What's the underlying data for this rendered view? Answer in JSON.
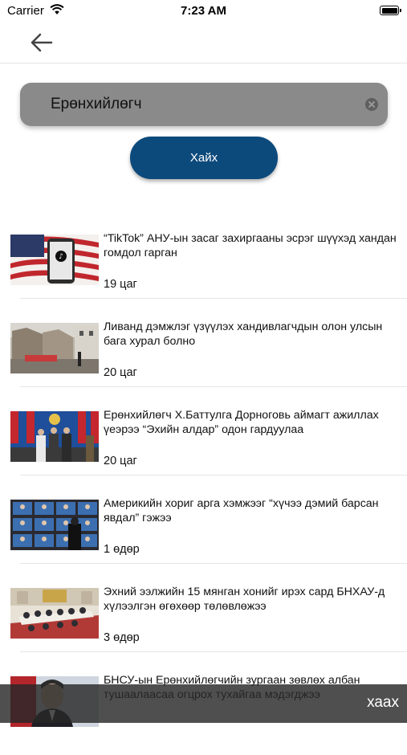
{
  "status_bar": {
    "carrier": "Carrier",
    "time": "7:23 AM"
  },
  "search": {
    "value": "Ерөнхийлөгч",
    "button_label": "Хайх"
  },
  "news": [
    {
      "title": "“TikTok” АНУ-ын засаг захиргааны эсрэг шүүхэд хандан гомдол гарган",
      "age": "19 цаг",
      "thumb": "tiktok-flag"
    },
    {
      "title": "Ливанд дэмжлэг үзүүлэх хандивлагчдын олон улсын бага хурал болно",
      "age": "20 цаг",
      "thumb": "ruins"
    },
    {
      "title": "Ерөнхийлөгч Х.Баттулга Дорноговь аймагт ажиллах үеэрээ “Эхийн алдар” одон гардуулаа",
      "age": "20 цаг",
      "thumb": "ceremony"
    },
    {
      "title": "Америкийн хориг арга хэмжээг “хүчээ дэмий барсан явдал” гэжээ",
      "age": "1 өдөр",
      "thumb": "video-wall"
    },
    {
      "title": "Эхний ээлжийн 15 мянган хонийг ирэх сард БНХАУ-д хүлээлгэн өгөхөөр төлөвлөжээ",
      "age": "3 өдөр",
      "thumb": "meeting"
    },
    {
      "title": "БНСУ-ын Ерөнхийлөгчийн зургаан зөвлөх албан тушаалаасаа огцрох тухайгаа мэдэгджээ",
      "age": "",
      "thumb": "portrait"
    }
  ],
  "banner": {
    "close_label": "хаах"
  }
}
